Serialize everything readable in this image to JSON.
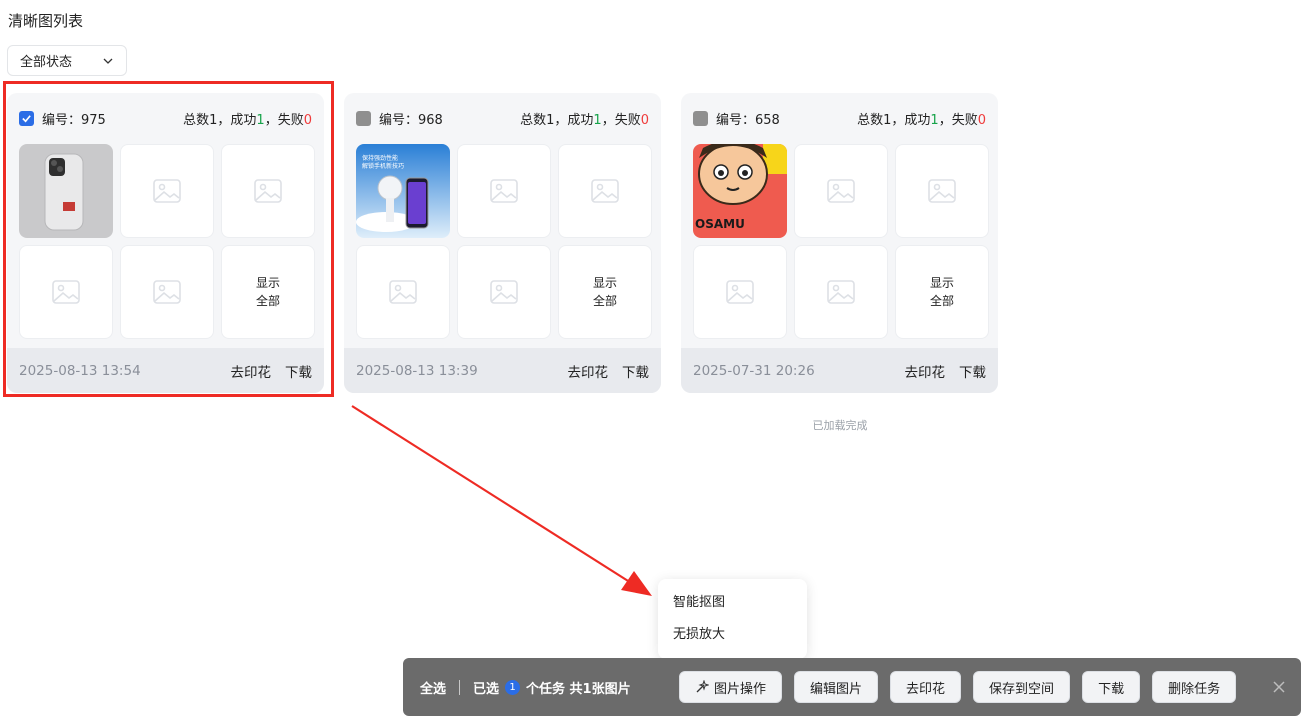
{
  "page": {
    "title": "清晰图列表"
  },
  "filter": {
    "selected": "全部状态"
  },
  "cards": [
    {
      "id_label": "编号：975",
      "total": "总数1，成功",
      "success": "1",
      "sep": "，失败",
      "fail": "0",
      "date": "2025-08-13 13:54",
      "show_all_line1": "显示",
      "show_all_line2": "全部",
      "action_watermark": "去印花",
      "action_download": "下载",
      "checked": true
    },
    {
      "id_label": "编号：968",
      "total": "总数1，成功",
      "success": "1",
      "sep": "，失败",
      "fail": "0",
      "date": "2025-08-13 13:39",
      "show_all_line1": "显示",
      "show_all_line2": "全部",
      "action_watermark": "去印花",
      "action_download": "下载",
      "checked": false
    },
    {
      "id_label": "编号：658",
      "total": "总数1，成功",
      "success": "1",
      "sep": "，失败",
      "fail": "0",
      "date": "2025-07-31 20:26",
      "show_all_line1": "显示",
      "show_all_line2": "全部",
      "action_watermark": "去印花",
      "action_download": "下载",
      "checked": false
    }
  ],
  "thumbs": {
    "card2_line1": "保持强劲性能",
    "card2_line2": "解锁手机新技巧",
    "card3_text": "OSAMU"
  },
  "loaded_text": "已加载完成",
  "popup": {
    "items": [
      "智能抠图",
      "无损放大"
    ]
  },
  "bottom_bar": {
    "select_all": "全选",
    "selected_prefix": "已选",
    "selected_count": "1",
    "selected_suffix": "个任务 共1张图片",
    "buttons": [
      "图片操作",
      "编辑图片",
      "去印花",
      "保存到空间",
      "下载",
      "删除任务"
    ]
  },
  "colors": {
    "accent": "#2b6de6",
    "success": "#16a34a",
    "fail": "#ef3b3b",
    "highlight": "#ee2b24"
  }
}
